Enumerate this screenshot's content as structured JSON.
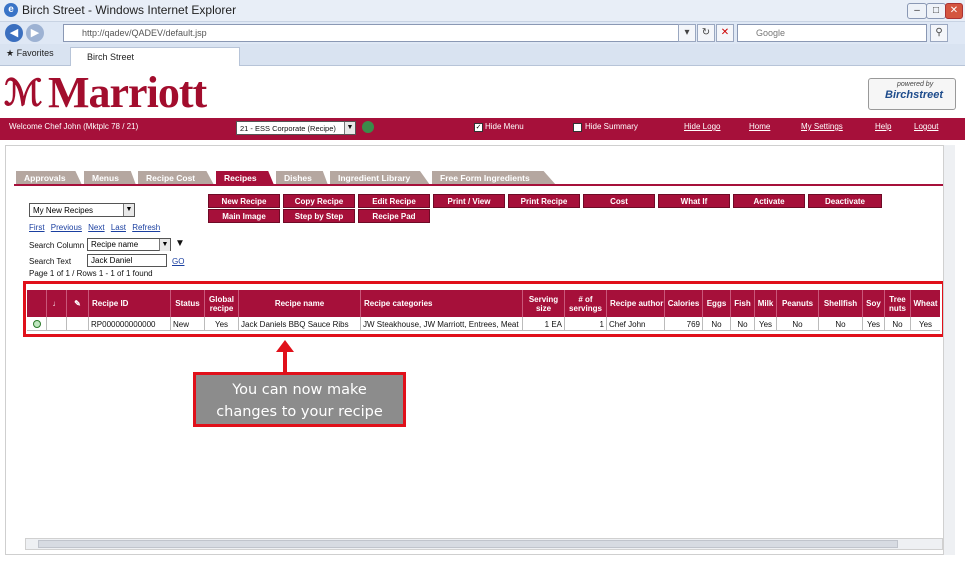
{
  "window": {
    "title": "Birch Street - Windows Internet Explorer",
    "url": "http://qadev/QADEV/default.jsp",
    "search_placeholder": "Google",
    "favorites": "Favorites",
    "tab_title": "Birch Street"
  },
  "brand": {
    "name": "Marriott",
    "powered_by": "powered by",
    "partner": "Birchstreet",
    "accent": "#a6103a"
  },
  "header": {
    "welcome": "Welcome Chef John (Mktplc 78 / 21)",
    "property_select": "21 - ESS Corporate (Recipe)",
    "hide_menu": "Hide Menu",
    "hide_summary": "Hide Summary",
    "links": [
      "Hide Logo",
      "Home",
      "My Settings",
      "Help",
      "Logout"
    ]
  },
  "tabs": [
    "Approvals",
    "Menus",
    "Recipe Cost",
    "Recipes",
    "Dishes",
    "Ingredient Library",
    "Free Form Ingredients"
  ],
  "active_tab": "Recipes",
  "view_select": "My New Recipes",
  "actions_row1": [
    "New Recipe",
    "Copy Recipe",
    "Edit Recipe",
    "Print / View",
    "Print Recipe",
    "Cost",
    "What If",
    "Activate",
    "Deactivate"
  ],
  "actions_row2": [
    "Main Image",
    "Step by Step",
    "Recipe Pad"
  ],
  "pager": {
    "links": [
      "First",
      "Previous",
      "Next",
      "Last",
      "Refresh"
    ],
    "search_column_label": "Search Column",
    "search_column_value": "Recipe name",
    "search_text_label": "Search Text",
    "search_text_value": "Jack Daniel",
    "go": "GO",
    "summary": "Page 1 of 1 / Rows 1 - 1 of 1 found"
  },
  "table": {
    "headers": [
      "",
      "",
      "",
      "Recipe ID",
      "Status",
      "Global recipe",
      "Recipe name",
      "Recipe categories",
      "Serving size",
      "# of servings",
      "Recipe author",
      "Calories",
      "Eggs",
      "Fish",
      "Milk",
      "Peanuts",
      "Shellfish",
      "Soy",
      "Tree nuts",
      "Wheat"
    ],
    "rows": [
      [
        "",
        "",
        "",
        "RP000000000000",
        "New",
        "Yes",
        "Jack Daniels BBQ Sauce Ribs",
        "JW Steakhouse, JW Marriott, Entrees, Meat",
        "1 EA",
        "1",
        "Chef John",
        "769",
        "No",
        "No",
        "Yes",
        "No",
        "No",
        "Yes",
        "No",
        "Yes"
      ]
    ]
  },
  "callout": {
    "line1": "You can now make",
    "line2": "changes to your recipe"
  }
}
